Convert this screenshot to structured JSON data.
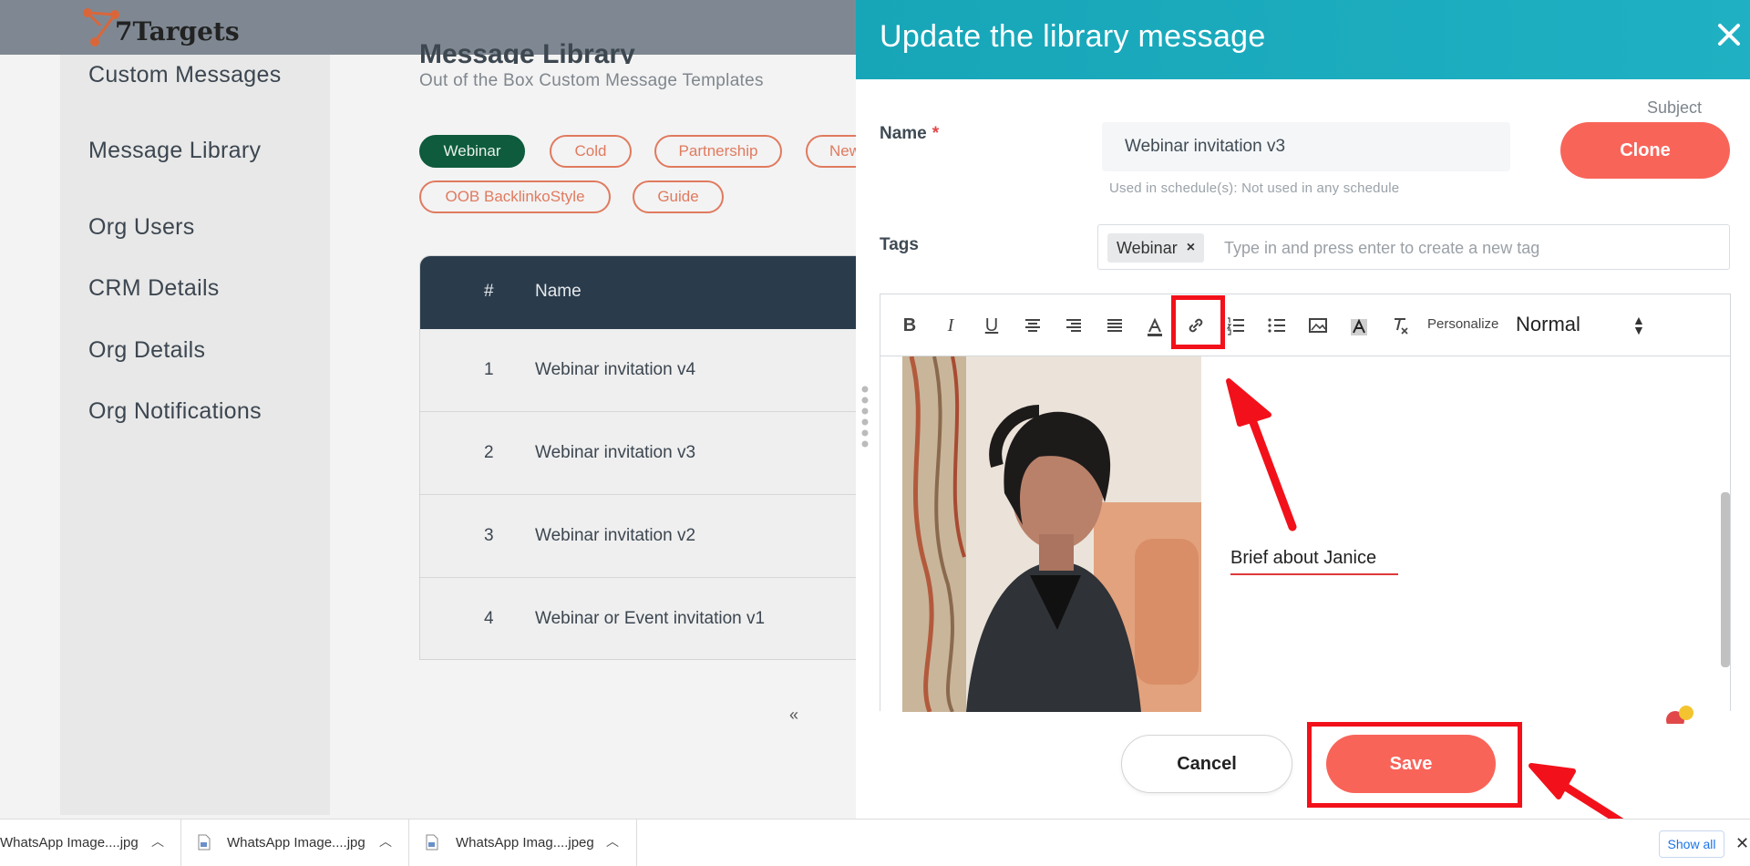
{
  "app": {
    "logo_text": "7Targets"
  },
  "sidebar": {
    "items": [
      {
        "label": "Custom Messages"
      },
      {
        "label": "Message Library"
      },
      {
        "label": "Org Users"
      },
      {
        "label": "CRM Details"
      },
      {
        "label": "Org Details"
      },
      {
        "label": "Org Notifications"
      }
    ]
  },
  "main": {
    "title": "Message Library",
    "subtitle": "Out of the Box Custom Message Templates",
    "filter_tags": [
      "Webinar",
      "Cold",
      "Partnership",
      "New",
      "OOB BacklinkoStyle",
      "Guide"
    ],
    "table": {
      "headers": [
        "#",
        "Name"
      ],
      "rows": [
        {
          "num": "1",
          "name": "Webinar invitation v4"
        },
        {
          "num": "2",
          "name": "Webinar invitation v3"
        },
        {
          "num": "3",
          "name": "Webinar invitation v2"
        },
        {
          "num": "4",
          "name": "Webinar or Event invitation v1"
        }
      ]
    },
    "pager_prev": "«"
  },
  "modal": {
    "title": "Update the library message",
    "name_label": "Name",
    "required_mark": "*",
    "name_value": "Webinar invitation v3",
    "subject_label": "Subject",
    "clone_label": "Clone",
    "used_in_text": "Used in schedule(s): Not used in any schedule",
    "tags_label": "Tags",
    "tags": [
      {
        "label": "Webinar",
        "remove": "×"
      }
    ],
    "tags_placeholder": "Type in and press enter to create a new tag",
    "toolbar": {
      "bold": "B",
      "italic": "I",
      "underline": "U",
      "personalize": "Personalize",
      "format_value": "Normal",
      "format_arrows": "▲▼"
    },
    "editor_text": "Brief about Janice",
    "cancel_label": "Cancel",
    "save_label": "Save"
  },
  "downloads": {
    "items": [
      {
        "name": "WhatsApp Image....jpg"
      },
      {
        "name": "WhatsApp Image....jpg"
      },
      {
        "name": "WhatsApp Imag....jpeg"
      }
    ],
    "show_all": "Show all",
    "close": "✕"
  },
  "colors": {
    "modal_header": "#17a6b8",
    "primary_button": "#f96459",
    "active_tag": "#0e5b3d",
    "tag_outline": "#e07a5f",
    "annotation": "#f2111a"
  }
}
